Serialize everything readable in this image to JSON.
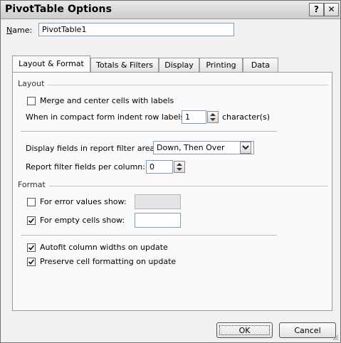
{
  "window": {
    "title": "PivotTable Options",
    "help_glyph": "?",
    "close_glyph": "✕"
  },
  "name_field": {
    "label": "Name:",
    "value": "PivotTable1"
  },
  "tabs": [
    {
      "label": "Layout & Format",
      "active": true
    },
    {
      "label": "Totals & Filters",
      "active": false
    },
    {
      "label": "Display",
      "active": false
    },
    {
      "label": "Printing",
      "active": false
    },
    {
      "label": "Data",
      "active": false
    }
  ],
  "layout_group": {
    "title": "Layout",
    "merge_label": "Merge and center cells with labels",
    "merge_checked": false,
    "indent_label": "When in compact form indent row labels:",
    "indent_value": "1",
    "indent_unit": "character(s)",
    "display_fields_label": "Display fields in report filter area:",
    "display_fields_value": "Down, Then Over",
    "per_column_label": "Report filter fields per column:",
    "per_column_value": "0"
  },
  "format_group": {
    "title": "Format",
    "error_label": "For error values show:",
    "error_checked": false,
    "error_value": "",
    "empty_label": "For empty cells show:",
    "empty_checked": true,
    "empty_value": "",
    "autofit_label": "Autofit column widths on update",
    "autofit_checked": true,
    "preserve_label": "Preserve cell formatting on update",
    "preserve_checked": true
  },
  "buttons": {
    "ok": "OK",
    "cancel": "Cancel"
  }
}
